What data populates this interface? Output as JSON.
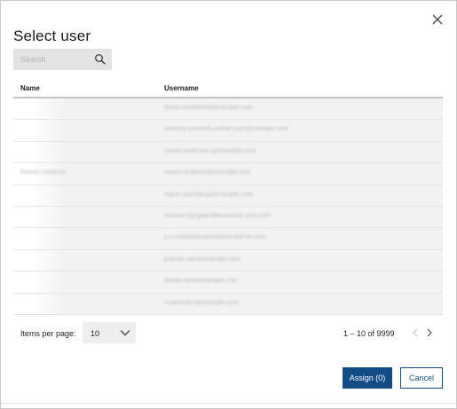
{
  "dialog": {
    "title": "Select user",
    "close_icon": "close-icon"
  },
  "search": {
    "placeholder": "Search",
    "icon": "search-icon"
  },
  "table": {
    "columns": [
      "Name",
      "Username"
    ],
    "rows": [
      {
        "name": "",
        "username": "devon.smithfield@example.com"
      },
      {
        "name": "",
        "username": "contoso.accounts.admin.user@example.com"
      },
      {
        "name": "",
        "username": "harriet.anderson.j@example.com"
      },
      {
        "name": "Marion Lindqvist",
        "username": "marion.lindqvist@example.com"
      },
      {
        "name": "",
        "username": "maria.rosenberg@example.com"
      },
      {
        "name": "",
        "username": "thomas.wyngaard@example-corp.com"
      },
      {
        "name": "",
        "username": "p.o.cristobalevans@example-fin.com"
      },
      {
        "name": "",
        "username": "jnielsen.ops@example.com"
      },
      {
        "name": "",
        "username": "kbaker.dev@example.com"
      },
      {
        "name": "",
        "username": "m.petersen@example.com"
      }
    ]
  },
  "paginator": {
    "items_per_page_label": "Items per page:",
    "items_per_page_value": "10",
    "range_label": "1 – 10 of 9999"
  },
  "actions": {
    "assign_label": "Assign (0)",
    "cancel_label": "Cancel"
  },
  "colors": {
    "primary": "#134c85",
    "search_bg": "#e3e3e3",
    "header_rule": "#c4c4c4"
  }
}
